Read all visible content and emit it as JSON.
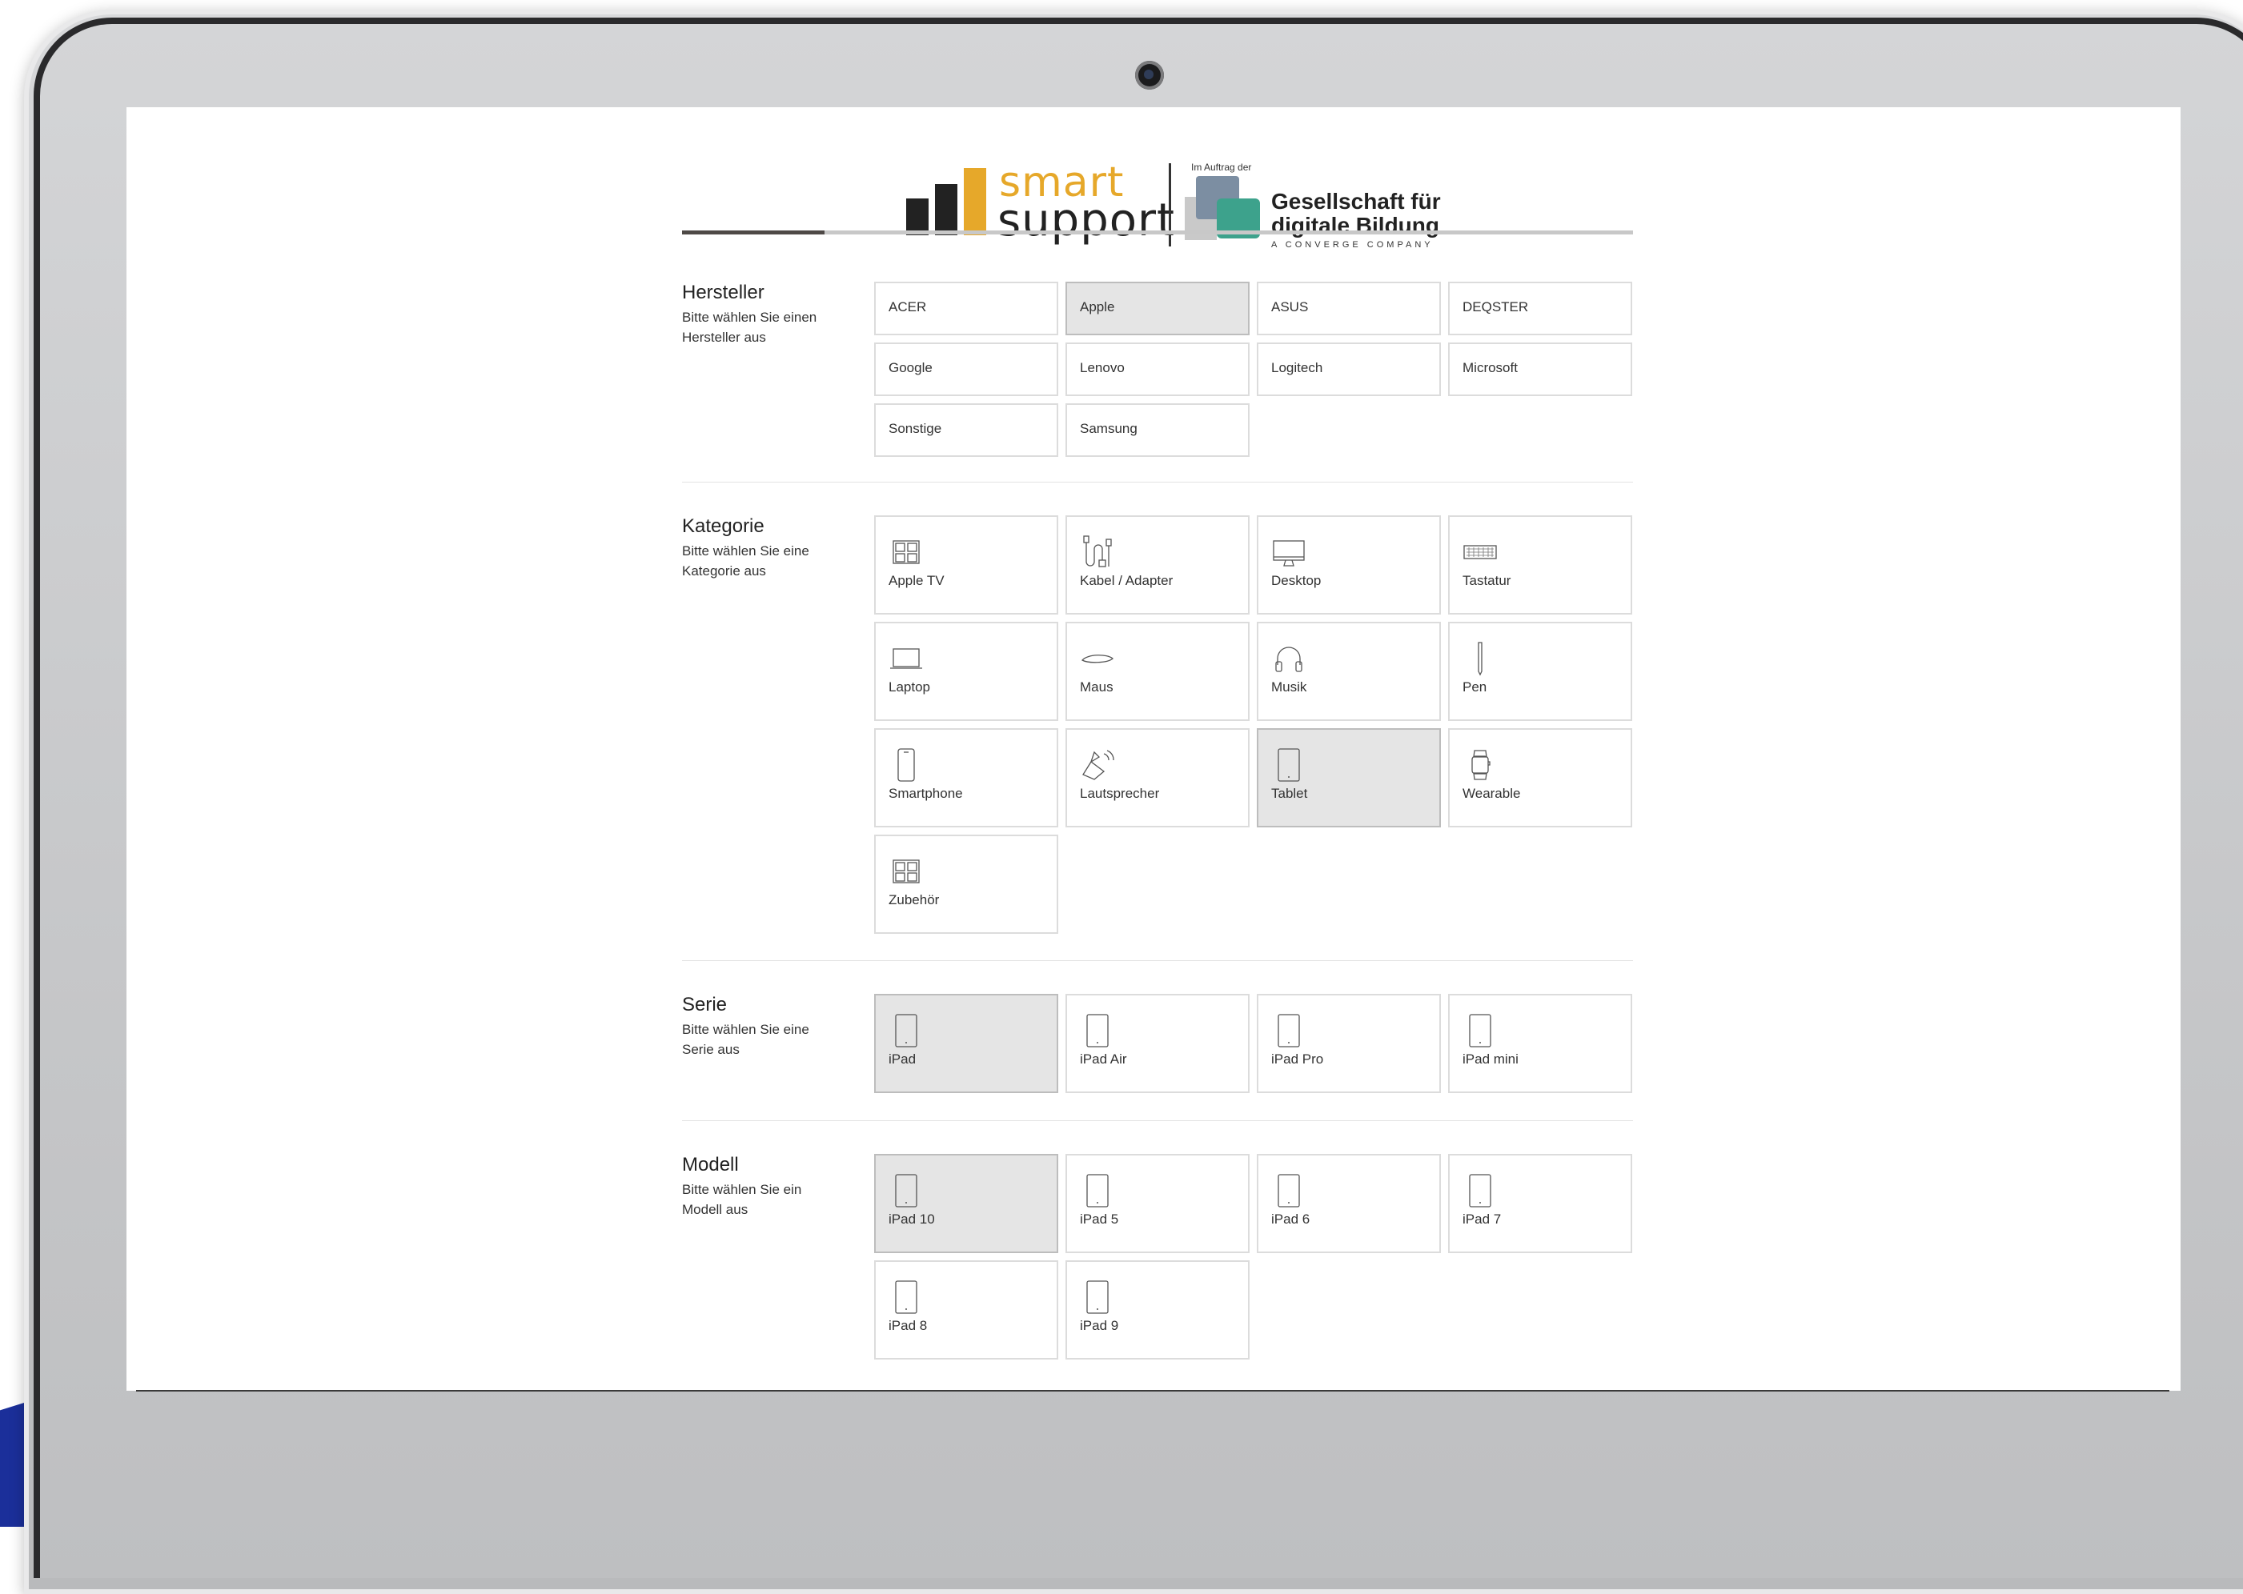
{
  "header": {
    "brand_smart": "smart",
    "brand_support": "support",
    "partner_small": "Im Auftrag der",
    "partner_line1": "Gesellschaft für",
    "partner_line2": "digitale Bildung",
    "partner_line3": "A CONVERGE COMPANY"
  },
  "progress": {
    "fraction": 0.15
  },
  "colors": {
    "accent_yellow": "#e6a82a",
    "gfdb_green": "#3da28c",
    "gfdb_blue": "#7c8ea2",
    "selected_bg": "#e5e5e5"
  },
  "sections": {
    "hersteller": {
      "title": "Hersteller",
      "desc": "Bitte wählen Sie einen Hersteller aus",
      "items": [
        "ACER",
        "Apple",
        "ASUS",
        "DEQSTER",
        "Google",
        "Lenovo",
        "Logitech",
        "Microsoft",
        "Sonstige",
        "Samsung"
      ],
      "selected": "Apple"
    },
    "kategorie": {
      "title": "Kategorie",
      "desc": "Bitte wählen Sie eine Kategorie aus",
      "items": [
        {
          "label": "Apple TV",
          "icon": "grid-box-icon"
        },
        {
          "label": "Kabel / Adapter",
          "icon": "cable-icon"
        },
        {
          "label": "Desktop",
          "icon": "desktop-icon"
        },
        {
          "label": "Tastatur",
          "icon": "keyboard-icon"
        },
        {
          "label": "Laptop",
          "icon": "laptop-icon"
        },
        {
          "label": "Maus",
          "icon": "mouse-icon"
        },
        {
          "label": "Musik",
          "icon": "headphones-icon"
        },
        {
          "label": "Pen",
          "icon": "pen-icon"
        },
        {
          "label": "Smartphone",
          "icon": "smartphone-icon"
        },
        {
          "label": "Lautsprecher",
          "icon": "speaker-icon"
        },
        {
          "label": "Tablet",
          "icon": "tablet-icon"
        },
        {
          "label": "Wearable",
          "icon": "watch-icon"
        },
        {
          "label": "Zubehör",
          "icon": "grid-box-icon"
        }
      ],
      "selected": "Tablet"
    },
    "serie": {
      "title": "Serie",
      "desc": "Bitte wählen Sie eine Serie aus",
      "items": [
        {
          "label": "iPad",
          "icon": "tablet-icon"
        },
        {
          "label": "iPad Air",
          "icon": "tablet-icon"
        },
        {
          "label": "iPad Pro",
          "icon": "tablet-icon"
        },
        {
          "label": "iPad mini",
          "icon": "tablet-icon"
        }
      ],
      "selected": "iPad"
    },
    "modell": {
      "title": "Modell",
      "desc": "Bitte wählen Sie ein Modell aus",
      "items": [
        {
          "label": "iPad 10",
          "icon": "tablet-icon"
        },
        {
          "label": "iPad 5",
          "icon": "tablet-icon"
        },
        {
          "label": "iPad 6",
          "icon": "tablet-icon"
        },
        {
          "label": "iPad 7",
          "icon": "tablet-icon"
        },
        {
          "label": "iPad 8",
          "icon": "tablet-icon"
        },
        {
          "label": "iPad 9",
          "icon": "tablet-icon"
        }
      ],
      "selected": "iPad 10"
    }
  }
}
